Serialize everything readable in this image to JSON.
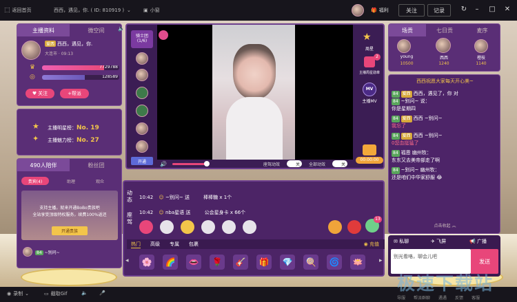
{
  "titlebar": {
    "back_label": "返回首页",
    "room_title": "西西，遇见，你. ( ID: 810919 )",
    "mini_label": "小窗",
    "welfare_label": "福利",
    "follow_label": "关注",
    "record_label": "记录"
  },
  "left_panel": {
    "tabs": [
      "主播资料",
      "微空间"
    ],
    "anchor_name": "西西，遇见，你.",
    "anchor_badge": "爱西",
    "location_time": "大连市 · 09:13",
    "exp_value": "7729788",
    "wealth_value": "128589",
    "follow_button": "关注",
    "support_button": "+帮派",
    "star_rank_label": "主播明星榜：",
    "star_rank_value": "No. 19",
    "charm_rank_label": "主播魅力榜：",
    "charm_rank_value": "No. 27",
    "viewer_tabs": [
      "490人陪伴",
      "粉丝团"
    ],
    "viewer_subtabs": [
      "贵宾(4)",
      "助理",
      "观众"
    ],
    "promo_text_1": "支持主播，就来开通BoBo贵族吧",
    "promo_text_2": "全站享受顶级特权服务，续费100%返还",
    "promo_button": "开通贵族",
    "viewer_item": "~别问~"
  },
  "video_area": {
    "knight_label": "骑士团",
    "knight_count": "(1/6)",
    "open_label": "开通",
    "right_labels": [
      "周星",
      "主播周星勋章",
      "主播MV"
    ],
    "mv_badge": "MV",
    "rank_count": "2",
    "seat_effect": "座驾动效",
    "full_effect": "全部动效",
    "toggle_off": "关",
    "timer": "00:00:00"
  },
  "gift_feed": {
    "labels": [
      "动态",
      "座驾"
    ],
    "rows": [
      {
        "time": "10:42",
        "user": "~别问~",
        "action": "送",
        "gift": "棒棒糖 x 1个"
      },
      {
        "time": "10:42",
        "user": "nba星语",
        "action": "送",
        "gift": "公会星身卡 x 66个"
      }
    ],
    "gift_tabs": [
      "热门",
      "高级",
      "专属",
      "包裹"
    ],
    "recharge_label": "充值",
    "chest_badge": "13",
    "gift_icons": [
      "🌸",
      "🌈",
      "👄",
      "🌹",
      "🎸",
      "🎁",
      "💎",
      "🍭",
      "🌀",
      "🪷"
    ]
  },
  "right_panel": {
    "tabs": [
      "场贡",
      "七日贡",
      "麦序"
    ],
    "contributors": [
      {
        "name": "young",
        "score": "10500",
        "rank": "2"
      },
      {
        "name": "西西",
        "score": "1240",
        "rank": "1"
      },
      {
        "name": "橙枝",
        "score": "1140",
        "rank": "3"
      }
    ],
    "notice": "西西祝愿大家每天开心美~",
    "messages": [
      {
        "user": "西西",
        "text": "遇见了，你 对"
      },
      {
        "user": "~别问~",
        "text": "说："
      },
      {
        "user": "",
        "text": "你是星期四"
      },
      {
        "user": "西西",
        "text": "~别问~"
      },
      {
        "user": "",
        "text": "我忘了"
      },
      {
        "user": "西西",
        "text": "~别问~"
      },
      {
        "user": "",
        "text": "0您血挺猛了"
      },
      {
        "user": "福恩",
        "text": "幽州牧："
      },
      {
        "user": "",
        "text": "东东又去美帝部走了啊"
      },
      {
        "user": "~别问~",
        "text": "幽州牧："
      },
      {
        "user": "",
        "text": "还是咱们中华家舒服 😂"
      }
    ],
    "collapse_label": "点击收起 ︽",
    "action_tabs": [
      "私聊",
      "飞屏",
      "广播"
    ],
    "input_placeholder": "别光看咯，聊会儿吧",
    "send_button": "发送"
  },
  "bottombar": {
    "record_label": "录制",
    "gif_label": "截取Gif",
    "right_labels": [
      "导服",
      "帮派群聊",
      "遇遇",
      "反馈",
      "客服"
    ]
  },
  "watermark": "极速下载站",
  "colors": {
    "panel_purple": "#5a2e76",
    "accent_pink": "#e8467a",
    "gold": "#f3c54a"
  }
}
